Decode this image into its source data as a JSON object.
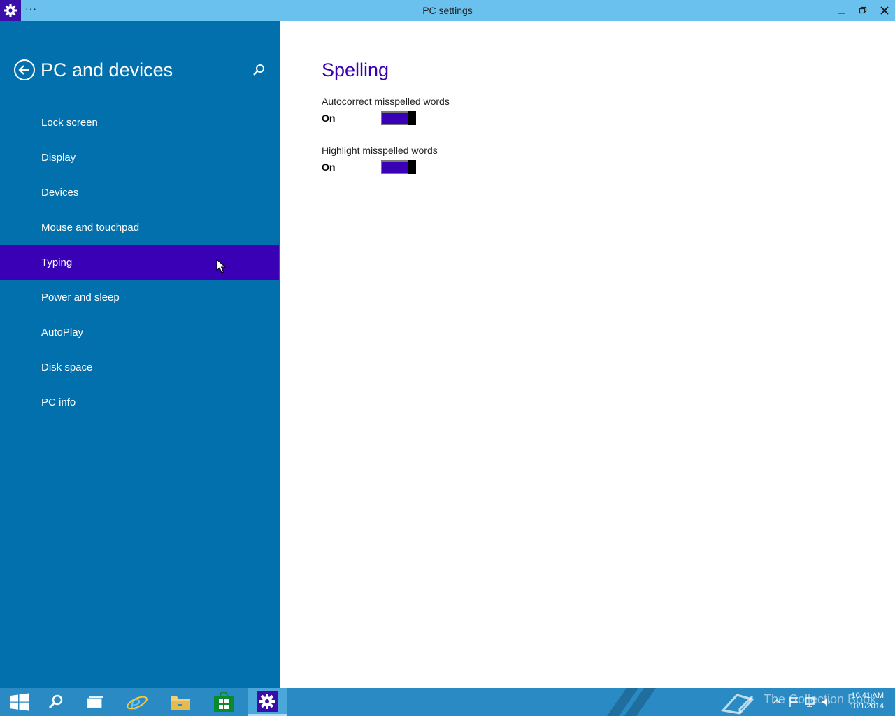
{
  "window": {
    "title": "PC settings",
    "menu_glyph": "···",
    "app_icon": "gear-icon"
  },
  "sidebar": {
    "title": "PC and devices",
    "items": [
      {
        "label": "Lock screen"
      },
      {
        "label": "Display"
      },
      {
        "label": "Devices"
      },
      {
        "label": "Mouse and touchpad"
      },
      {
        "label": "Typing"
      },
      {
        "label": "Power and sleep"
      },
      {
        "label": "AutoPlay"
      },
      {
        "label": "Disk space"
      },
      {
        "label": "PC info"
      }
    ],
    "selected": "Typing"
  },
  "content": {
    "section_title": "Spelling",
    "settings": [
      {
        "label": "Autocorrect misspelled words",
        "state": "On"
      },
      {
        "label": "Highlight misspelled words",
        "state": "On"
      }
    ]
  },
  "taskbar": {
    "clock_time": "10:41 AM",
    "clock_date": "10/1/2014",
    "watermark": "The Collection Book"
  },
  "colors": {
    "accent": "#3a00b5",
    "sidebar": "#0270ad",
    "titlebar": "#6bc1ee",
    "taskbar": "#2a8bc4"
  }
}
